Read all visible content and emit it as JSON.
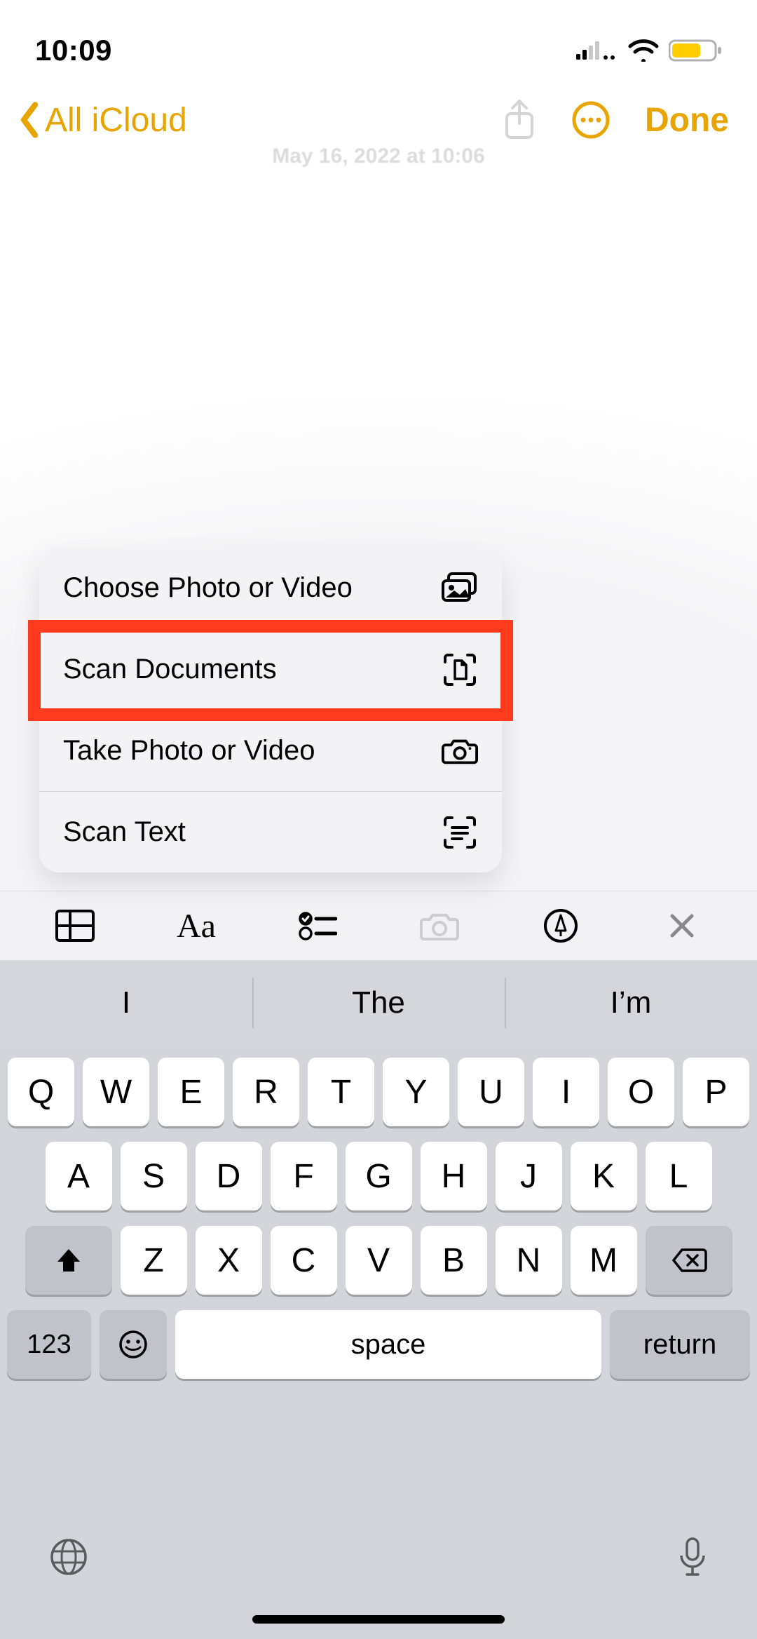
{
  "status": {
    "time": "10:09"
  },
  "nav": {
    "back_label": "All iCloud",
    "done_label": "Done"
  },
  "note": {
    "timestamp": "May 16, 2022 at 10:06"
  },
  "action_menu": {
    "items": [
      {
        "label": "Choose Photo or Video",
        "icon": "photo-stack-icon",
        "highlighted": false
      },
      {
        "label": "Scan Documents",
        "icon": "doc-viewfinder-icon",
        "highlighted": true
      },
      {
        "label": "Take Photo or Video",
        "icon": "camera-icon",
        "highlighted": false
      },
      {
        "label": "Scan Text",
        "icon": "text-viewfinder-icon",
        "highlighted": false
      }
    ]
  },
  "format_bar": {
    "items": [
      "table-icon",
      "text-format-icon",
      "checklist-icon",
      "camera-icon",
      "markup-icon",
      "close-icon"
    ]
  },
  "quicktype": {
    "suggestions": [
      "I",
      "The",
      "I’m"
    ]
  },
  "keyboard": {
    "row1": [
      "Q",
      "W",
      "E",
      "R",
      "T",
      "Y",
      "U",
      "I",
      "O",
      "P"
    ],
    "row2": [
      "A",
      "S",
      "D",
      "F",
      "G",
      "H",
      "J",
      "K",
      "L"
    ],
    "row3": [
      "Z",
      "X",
      "C",
      "V",
      "B",
      "N",
      "M"
    ],
    "num_key": "123",
    "space_label": "space",
    "return_label": "return"
  }
}
